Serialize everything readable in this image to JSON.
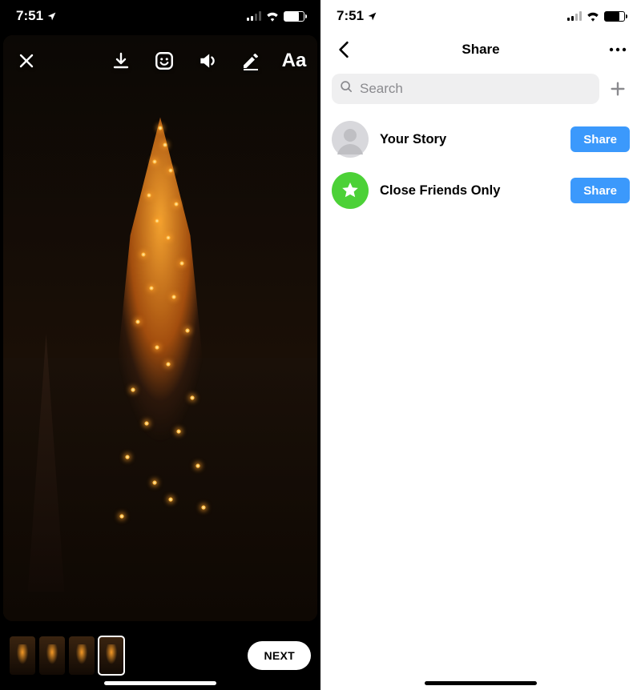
{
  "status_bar": {
    "time": "7:51"
  },
  "left": {
    "toolbar": {
      "text_tool_label": "Aa"
    },
    "thumbnails": {
      "count": 4,
      "selected_index": 3
    },
    "next_button_label": "NEXT"
  },
  "right": {
    "nav": {
      "title": "Share"
    },
    "search": {
      "placeholder": "Search"
    },
    "rows": [
      {
        "label": "Your Story",
        "button": "Share",
        "avatar": "profile"
      },
      {
        "label": "Close Friends Only",
        "button": "Share",
        "avatar": "close-friends"
      }
    ]
  }
}
